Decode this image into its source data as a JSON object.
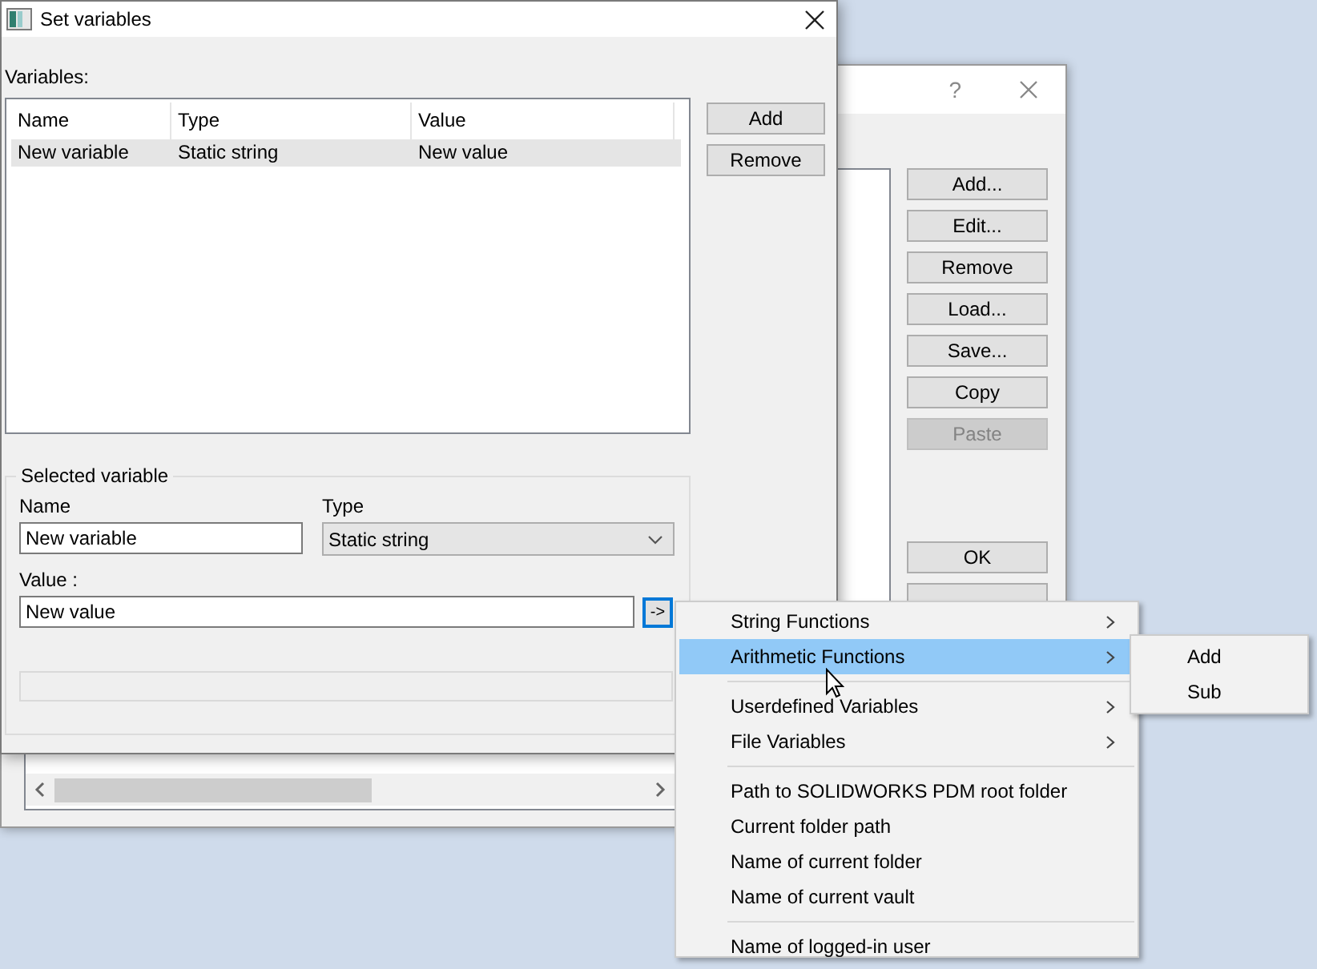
{
  "back_window": {
    "help": "?",
    "buttons": [
      {
        "label": "Add...",
        "disabled": false
      },
      {
        "label": "Edit...",
        "disabled": false
      },
      {
        "label": "Remove",
        "disabled": false
      },
      {
        "label": "Load...",
        "disabled": false
      },
      {
        "label": "Save...",
        "disabled": false
      },
      {
        "label": "Copy",
        "disabled": false
      },
      {
        "label": "Paste",
        "disabled": true
      }
    ],
    "ok_button": "OK"
  },
  "dialog": {
    "title": "Set variables",
    "variables_label": "Variables:",
    "columns": [
      "Name",
      "Type",
      "Value"
    ],
    "rows": [
      {
        "cells": [
          "New variable",
          "Static string",
          "New value"
        ],
        "selected": true
      }
    ],
    "buttons": [
      "Add",
      "Remove"
    ],
    "group": {
      "title": "Selected variable",
      "name_label": "Name",
      "name_value": "New variable",
      "type_label": "Type",
      "type_value": "Static string",
      "value_label": "Value :",
      "value_value": "New value",
      "insert_button": "->"
    }
  },
  "menu": {
    "items": [
      {
        "kind": "item",
        "label": "String Functions",
        "submenu": true,
        "selected": false
      },
      {
        "kind": "item",
        "label": "Arithmetic Functions",
        "submenu": true,
        "selected": true
      },
      {
        "kind": "separator"
      },
      {
        "kind": "item",
        "label": "Userdefined Variables",
        "submenu": true,
        "selected": false
      },
      {
        "kind": "item",
        "label": "File Variables",
        "submenu": true,
        "selected": false
      },
      {
        "kind": "separator"
      },
      {
        "kind": "item",
        "label": "Path to SOLIDWORKS PDM root folder",
        "submenu": false,
        "selected": false
      },
      {
        "kind": "item",
        "label": "Current folder path",
        "submenu": false,
        "selected": false
      },
      {
        "kind": "item",
        "label": "Name of current folder",
        "submenu": false,
        "selected": false
      },
      {
        "kind": "item",
        "label": "Name of current vault",
        "submenu": false,
        "selected": false
      },
      {
        "kind": "separator"
      },
      {
        "kind": "item",
        "label": "Name of logged-in user",
        "submenu": false,
        "selected": false
      }
    ]
  },
  "submenu": {
    "items": [
      "Add",
      "Sub"
    ]
  }
}
